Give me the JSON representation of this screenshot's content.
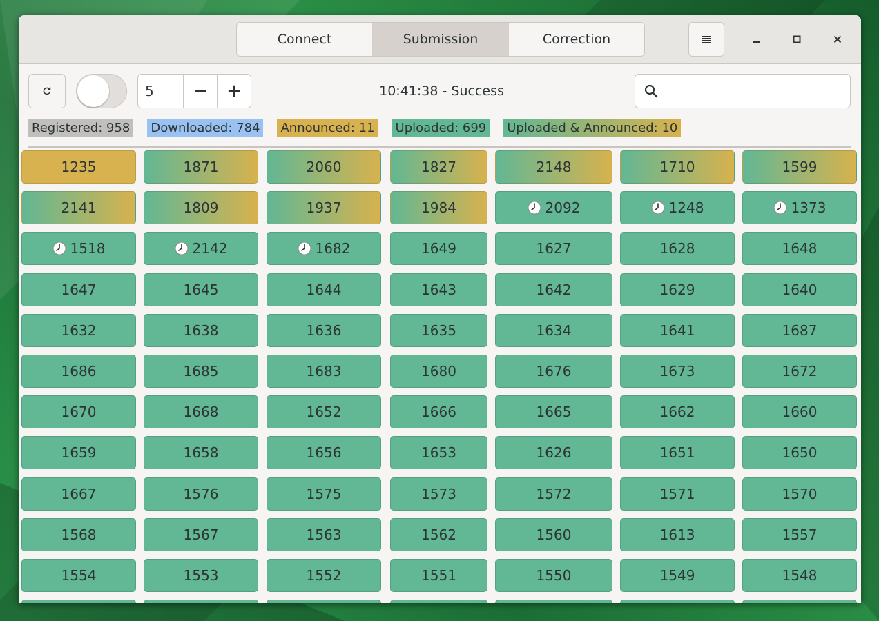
{
  "tabs": [
    "Connect",
    "Submission",
    "Correction"
  ],
  "active_tab": 1,
  "toolbar": {
    "spin_value": "5",
    "minus_label": "−",
    "plus_label": "+",
    "status": "10:41:38 - Success",
    "search_placeholder": ""
  },
  "legend": {
    "registered": "Registered: 958",
    "downloaded": "Downloaded: 784",
    "announced": "Announced: 11",
    "uploaded": "Uploaded: 699",
    "uploaded_announced": "Uploaded & Announced: 10"
  },
  "colors": {
    "uploaded": "#62b794",
    "announced": "#d7b24e",
    "downloaded": "#99c1f1",
    "registered": "#c0bfbc"
  },
  "icons": {
    "refresh": "refresh-icon",
    "search": "search-icon",
    "menu": "menu-icon",
    "minimize": "minimize-icon",
    "maximize": "maximize-icon",
    "close": "close-icon",
    "clock": "clock-icon"
  },
  "cells": [
    [
      {
        "n": "1235",
        "s": "ann"
      },
      {
        "n": "1871",
        "s": "grad"
      },
      {
        "n": "2060",
        "s": "grad"
      },
      {
        "n": "1827",
        "s": "grad"
      },
      {
        "n": "2148",
        "s": "grad"
      },
      {
        "n": "1710",
        "s": "grad"
      },
      {
        "n": "1599",
        "s": "grad"
      }
    ],
    [
      {
        "n": "2141",
        "s": "grad"
      },
      {
        "n": "1809",
        "s": "grad"
      },
      {
        "n": "1937",
        "s": "grad"
      },
      {
        "n": "1984",
        "s": "grad"
      },
      {
        "n": "2092",
        "s": "up",
        "clock": true
      },
      {
        "n": "1248",
        "s": "up",
        "clock": true
      },
      {
        "n": "1373",
        "s": "up",
        "clock": true
      }
    ],
    [
      {
        "n": "1518",
        "s": "up",
        "clock": true
      },
      {
        "n": "2142",
        "s": "up",
        "clock": true
      },
      {
        "n": "1682",
        "s": "up",
        "clock": true
      },
      {
        "n": "1649",
        "s": "up"
      },
      {
        "n": "1627",
        "s": "up"
      },
      {
        "n": "1628",
        "s": "up"
      },
      {
        "n": "1648",
        "s": "up"
      }
    ],
    [
      {
        "n": "1647",
        "s": "up"
      },
      {
        "n": "1645",
        "s": "up"
      },
      {
        "n": "1644",
        "s": "up"
      },
      {
        "n": "1643",
        "s": "up"
      },
      {
        "n": "1642",
        "s": "up"
      },
      {
        "n": "1629",
        "s": "up"
      },
      {
        "n": "1640",
        "s": "up"
      }
    ],
    [
      {
        "n": "1632",
        "s": "up"
      },
      {
        "n": "1638",
        "s": "up"
      },
      {
        "n": "1636",
        "s": "up"
      },
      {
        "n": "1635",
        "s": "up"
      },
      {
        "n": "1634",
        "s": "up"
      },
      {
        "n": "1641",
        "s": "up"
      },
      {
        "n": "1687",
        "s": "up"
      }
    ],
    [
      {
        "n": "1686",
        "s": "up"
      },
      {
        "n": "1685",
        "s": "up"
      },
      {
        "n": "1683",
        "s": "up"
      },
      {
        "n": "1680",
        "s": "up"
      },
      {
        "n": "1676",
        "s": "up"
      },
      {
        "n": "1673",
        "s": "up"
      },
      {
        "n": "1672",
        "s": "up"
      }
    ],
    [
      {
        "n": "1670",
        "s": "up"
      },
      {
        "n": "1668",
        "s": "up"
      },
      {
        "n": "1652",
        "s": "up"
      },
      {
        "n": "1666",
        "s": "up"
      },
      {
        "n": "1665",
        "s": "up"
      },
      {
        "n": "1662",
        "s": "up"
      },
      {
        "n": "1660",
        "s": "up"
      }
    ],
    [
      {
        "n": "1659",
        "s": "up"
      },
      {
        "n": "1658",
        "s": "up"
      },
      {
        "n": "1656",
        "s": "up"
      },
      {
        "n": "1653",
        "s": "up"
      },
      {
        "n": "1626",
        "s": "up"
      },
      {
        "n": "1651",
        "s": "up"
      },
      {
        "n": "1650",
        "s": "up"
      }
    ],
    [
      {
        "n": "1667",
        "s": "up"
      },
      {
        "n": "1576",
        "s": "up"
      },
      {
        "n": "1575",
        "s": "up"
      },
      {
        "n": "1573",
        "s": "up"
      },
      {
        "n": "1572",
        "s": "up"
      },
      {
        "n": "1571",
        "s": "up"
      },
      {
        "n": "1570",
        "s": "up"
      }
    ],
    [
      {
        "n": "1568",
        "s": "up"
      },
      {
        "n": "1567",
        "s": "up"
      },
      {
        "n": "1563",
        "s": "up"
      },
      {
        "n": "1562",
        "s": "up"
      },
      {
        "n": "1560",
        "s": "up"
      },
      {
        "n": "1613",
        "s": "up"
      },
      {
        "n": "1557",
        "s": "up"
      }
    ],
    [
      {
        "n": "1554",
        "s": "up"
      },
      {
        "n": "1553",
        "s": "up"
      },
      {
        "n": "1552",
        "s": "up"
      },
      {
        "n": "1551",
        "s": "up"
      },
      {
        "n": "1550",
        "s": "up"
      },
      {
        "n": "1549",
        "s": "up"
      },
      {
        "n": "1548",
        "s": "up"
      }
    ]
  ]
}
